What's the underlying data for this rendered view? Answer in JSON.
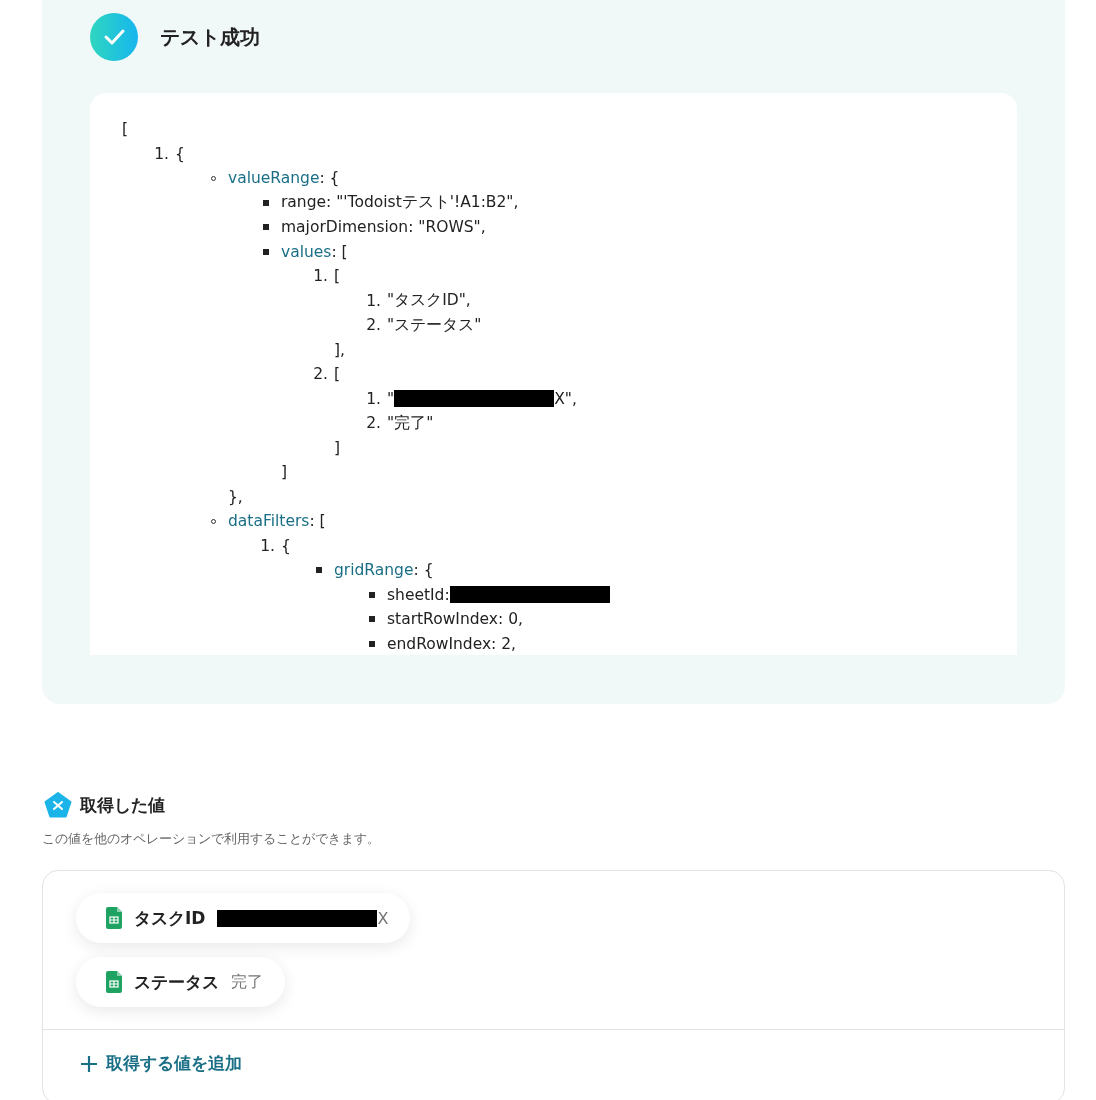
{
  "test_result": {
    "title": "テスト成功",
    "code": {
      "text": "[",
      "children": [
        {
          "marker": "1.",
          "text": "{",
          "children": [
            {
              "kind": "circle",
              "key": "valueRange",
              "text": ": {",
              "close": "},",
              "children": [
                {
                  "kind": "square",
                  "text": "range: \"'Todoistテスト'!A1:B2\","
                },
                {
                  "kind": "square",
                  "text": "majorDimension: \"ROWS\","
                },
                {
                  "kind": "square",
                  "key": "values",
                  "text": ": [",
                  "close": "]",
                  "children": [
                    {
                      "marker": "1.",
                      "text": "[",
                      "close": "],",
                      "children": [
                        {
                          "marker": "1.",
                          "text": "\"タスクID\","
                        },
                        {
                          "marker": "2.",
                          "text": "\"ステータス\""
                        }
                      ]
                    },
                    {
                      "marker": "2.",
                      "text": "[",
                      "close": "]",
                      "children": [
                        {
                          "marker": "1.",
                          "text": "\"",
                          "redacted": true,
                          "after": "X\","
                        },
                        {
                          "marker": "2.",
                          "text": "\"完了\""
                        }
                      ]
                    }
                  ]
                }
              ]
            },
            {
              "kind": "circle",
              "key": "dataFilters",
              "text": ": [",
              "children": [
                {
                  "marker": "1.",
                  "text": "{",
                  "children": [
                    {
                      "kind": "square",
                      "key": "gridRange",
                      "text": ": {",
                      "children": [
                        {
                          "kind": "square",
                          "text": "sheetId: ",
                          "redacted": true
                        },
                        {
                          "kind": "square",
                          "text": "startRowIndex: 0,"
                        },
                        {
                          "kind": "square",
                          "text": "endRowIndex: 2,"
                        }
                      ]
                    }
                  ]
                }
              ]
            }
          ]
        }
      ]
    }
  },
  "obtained_values": {
    "title": "取得した値",
    "description": "この値を他のオペレーションで利用することができます。",
    "items": [
      {
        "label": "タスクID",
        "redacted": true,
        "value": "X"
      },
      {
        "label": "ステータス",
        "value": "完了"
      }
    ],
    "add_button": "取得する値を追加"
  }
}
